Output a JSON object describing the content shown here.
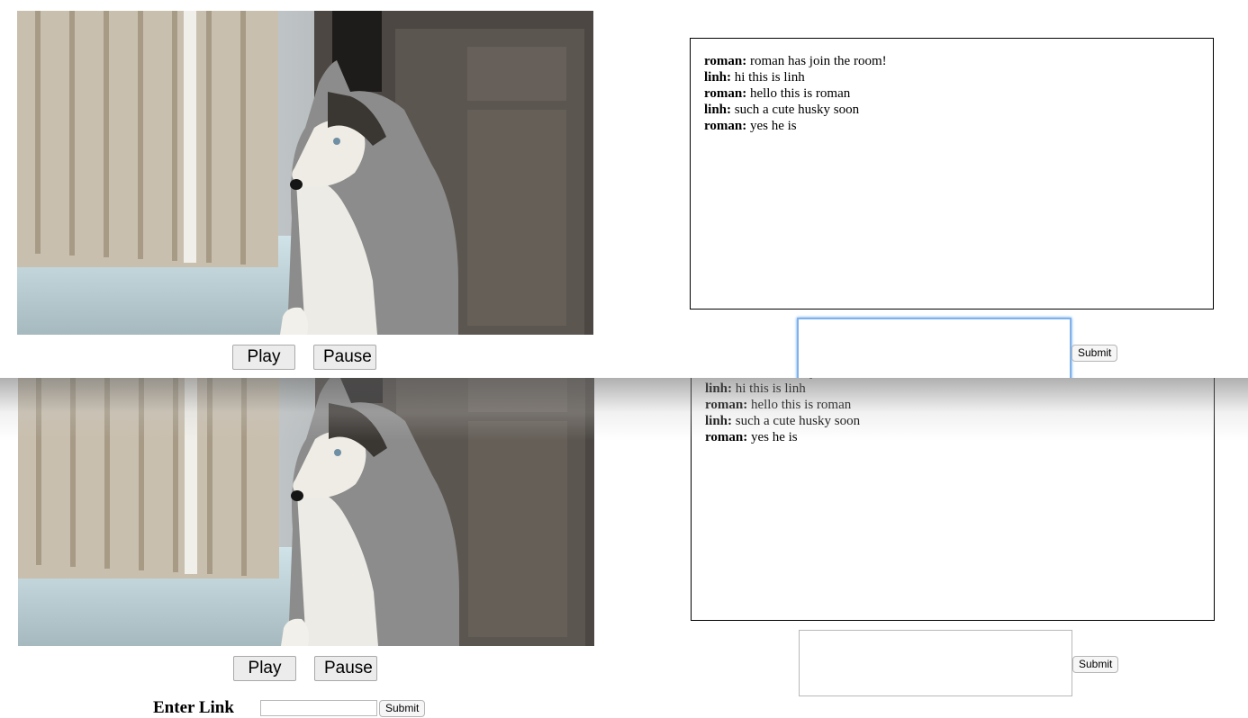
{
  "player": {
    "play_label": "Play",
    "pause_label": "Pause"
  },
  "chat": {
    "messages": [
      {
        "user": "roman:",
        "text": " roman has join the room!"
      },
      {
        "user": "linh:",
        "text": " hi this is linh"
      },
      {
        "user": "roman:",
        "text": " hello this is roman"
      },
      {
        "user": "linh:",
        "text": " such a cute husky soon"
      },
      {
        "user": "roman:",
        "text": " yes he is"
      }
    ],
    "submit_label": "Submit"
  },
  "link_form": {
    "label": "Enter Link",
    "submit_label": "Submit"
  },
  "colors": {
    "input_focus": "#7fb2ea",
    "button_bg": "#ececec"
  }
}
